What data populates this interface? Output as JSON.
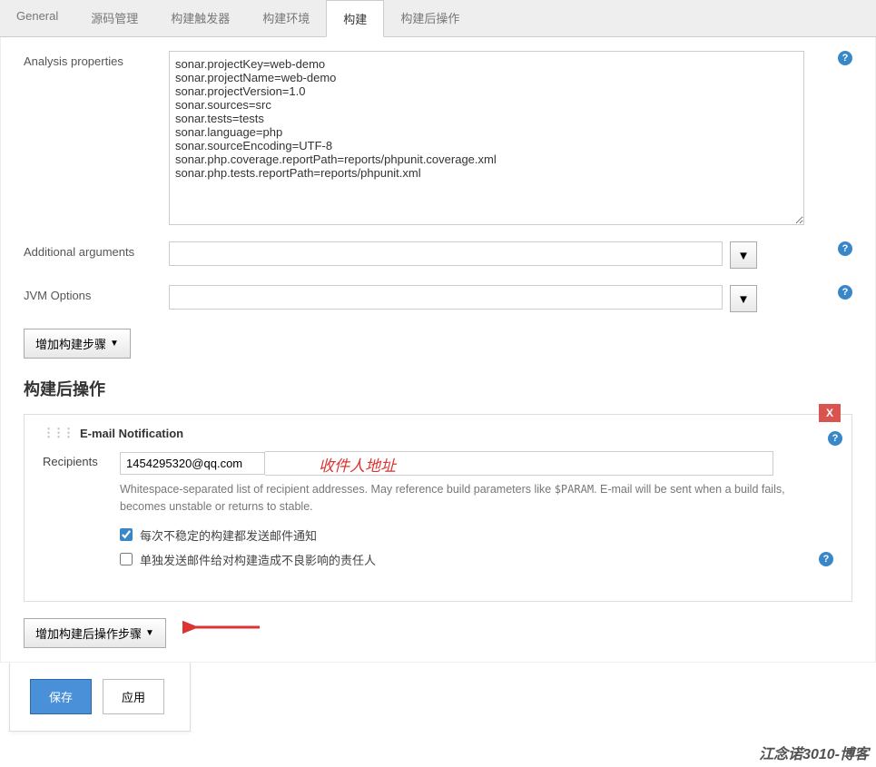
{
  "tabs": [
    "General",
    "源码管理",
    "构建触发器",
    "构建环境",
    "构建",
    "构建后操作"
  ],
  "active_tab": 4,
  "build": {
    "analysis_label": "Analysis properties",
    "analysis_value": "sonar.projectKey=web-demo\nsonar.projectName=web-demo\nsonar.projectVersion=1.0\nsonar.sources=src\nsonar.tests=tests\nsonar.language=php\nsonar.sourceEncoding=UTF-8\nsonar.php.coverage.reportPath=reports/phpunit.coverage.xml\nsonar.php.tests.reportPath=reports/phpunit.xml",
    "additional_label": "Additional arguments",
    "additional_value": "",
    "jvm_label": "JVM Options",
    "jvm_value": "",
    "add_step": "增加构建步骤"
  },
  "post": {
    "section": "构建后操作",
    "panel_title": "E-mail Notification",
    "recipients_label": "Recipients",
    "recipients_value": "1454295320@qq.com",
    "hint_pre": "Whitespace-separated list of recipient addresses. May reference build parameters like ",
    "hint_param": "$PARAM",
    "hint_post": ". E-mail will be sent when a build fails, becomes unstable or returns to stable.",
    "chk1_label": "每次不稳定的构建都发送邮件通知",
    "chk1_checked": true,
    "chk2_label": "单独发送邮件给对构建造成不良影响的责任人",
    "chk2_checked": false,
    "add_post": "增加构建后操作步骤",
    "annotation": "收件人地址"
  },
  "footer": {
    "save": "保存",
    "apply": "应用"
  },
  "watermark": "江念诺3010-博客",
  "icons": {
    "dropdown": "▼",
    "close": "X",
    "help": "?"
  }
}
